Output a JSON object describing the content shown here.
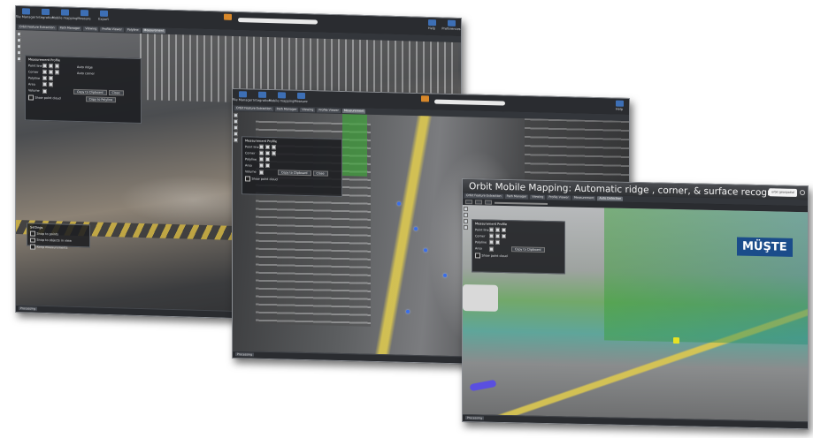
{
  "toolbar": {
    "buttons": [
      "File Manager",
      "Integration",
      "Mobile mapping",
      "Measure",
      "Export"
    ],
    "right_buttons": [
      "Help",
      "Preferences",
      "About"
    ]
  },
  "tabs": [
    "Orbit Feature Extraction",
    "Path Manager",
    "Viewing",
    "Profile Viewer",
    "Polyline",
    "Measurement",
    "Point Cloud",
    "Auto Detection"
  ],
  "panel": {
    "title": "Measurement Profile",
    "rows": [
      {
        "label": "Point line",
        "value": "Auto ridge"
      },
      {
        "label": "Corner",
        "value": "Auto corner"
      },
      {
        "label": "Polyline",
        "value": ""
      },
      {
        "label": "Area",
        "value": ""
      },
      {
        "label": "Volume",
        "value": ""
      }
    ],
    "buttons": [
      "Copy to Clipboard",
      "Close"
    ],
    "extra_button": "Copy to Polyline",
    "checkbox": "Show point cloud"
  },
  "settings_panel": {
    "title": "Settings",
    "options": [
      "Snap to points",
      "Snap to objects in view",
      "Keep measurements"
    ]
  },
  "status": "Processing",
  "win3": {
    "title": "Orbit Mobile Mapping: Automatic ridge , corner, & surface recognition",
    "logo": "orbit geospatial",
    "sign_text": "MÜŞTE"
  },
  "colors": {
    "accent": "#3d6fb5",
    "highlight": "#d8882a",
    "window_bg": "#1d1f22",
    "frame": "#8a8d92"
  }
}
